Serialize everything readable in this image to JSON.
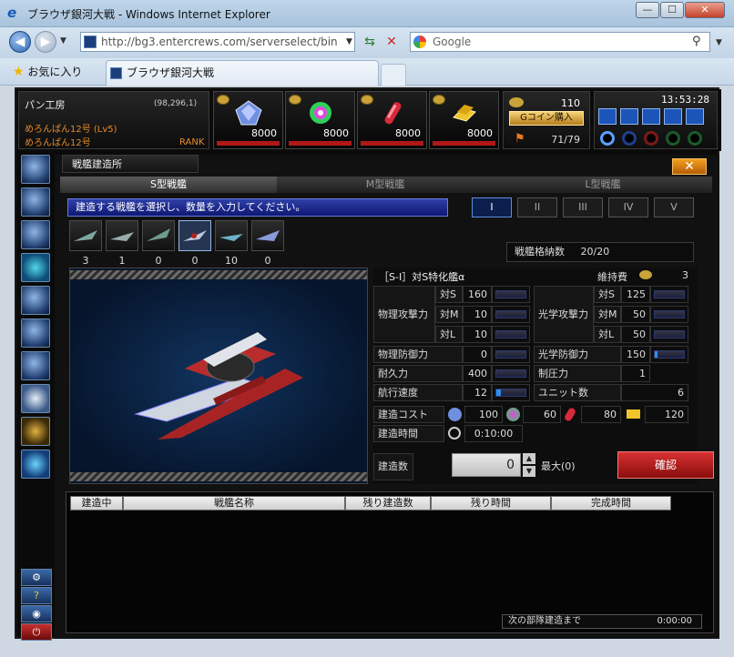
{
  "browser": {
    "title": "ブラウザ銀河大戦 - Windows Internet Explorer",
    "url": "http://bg3.entercrews.com/serverselect/bin",
    "search_placeholder": "Google",
    "favorites": "お気に入り",
    "tab_title": "ブラウザ銀河大戦",
    "min": "—",
    "max": "☐",
    "close": "✕"
  },
  "player": {
    "name": "パン工房",
    "coords": "(98,296,1)",
    "line1": "めろんぱん12号 (Lv5)",
    "line2": "めろんぱん12号",
    "rank": "RANK"
  },
  "resources": [
    {
      "value": "8000",
      "icon": "crystal-icon"
    },
    {
      "value": "8000",
      "icon": "energy-orb-icon"
    },
    {
      "value": "8000",
      "icon": "capsule-icon"
    },
    {
      "value": "8000",
      "icon": "gold-bar-icon"
    }
  ],
  "gcoin": {
    "value": "110",
    "buy": "Gコイン購入",
    "fleet": "71/79"
  },
  "clock": "13:53:28",
  "window": {
    "title": "戦艦建造所",
    "close": "✕"
  },
  "tabs": [
    "S型戦艦",
    "M型戦艦",
    "L型戦艦"
  ],
  "instruction": "建造する戦艦を選択し、数量を入力してください。",
  "tiers": [
    "I",
    "II",
    "III",
    "IV",
    "V"
  ],
  "ships": [
    "3",
    "1",
    "0",
    "0",
    "10",
    "0"
  ],
  "capacity": {
    "label": "戦艦格納数",
    "value": "20/20"
  },
  "ship": {
    "name": "［S-I］対S特化艦α",
    "upkeep_label": "維持費",
    "upkeep": "3"
  },
  "stats": {
    "phys_atk": "物理攻撃力",
    "opt_atk": "光学攻撃力",
    "vs_s": "対S",
    "vs_m": "対M",
    "vs_l": "対L",
    "phys_s": "160",
    "phys_m": "10",
    "phys_l": "10",
    "opt_s": "125",
    "opt_m": "50",
    "opt_l": "50",
    "phys_def": "物理防御力",
    "phys_def_v": "0",
    "opt_def": "光学防御力",
    "opt_def_v": "150",
    "dur": "耐久力",
    "dur_v": "400",
    "supp": "制圧力",
    "supp_v": "1",
    "speed": "航行速度",
    "speed_v": "12",
    "units": "ユニット数",
    "units_v": "6",
    "cost": "建造コスト",
    "c1": "100",
    "c2": "60",
    "c3": "80",
    "c4": "120",
    "time": "建造時間",
    "time_v": "0:10:00"
  },
  "bars": {
    "phys_s": 0,
    "phys_m": 0,
    "phys_l": 0,
    "opt_s": 0,
    "opt_m": 0,
    "opt_l": 0,
    "phys_def": 0,
    "opt_def": 0.1,
    "dur": 0,
    "speed": 0.15
  },
  "build": {
    "label": "建造数",
    "value": "0",
    "max": "最大(0)",
    "confirm": "確認"
  },
  "queue": {
    "headers": [
      "建造中",
      "戦艦名称",
      "残り建造数",
      "残り時間",
      "完成時間"
    ],
    "next_label": "次の部隊建造まで",
    "next_time": "0:00:00"
  }
}
